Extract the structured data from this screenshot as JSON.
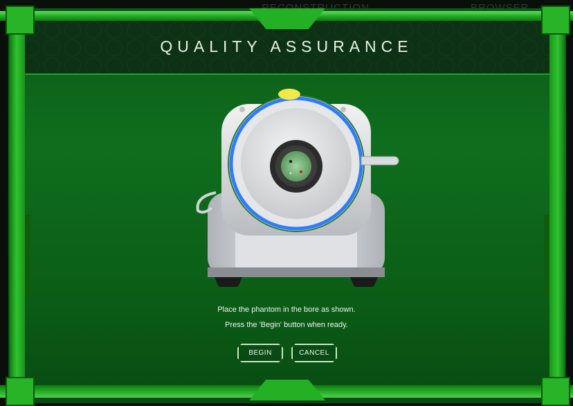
{
  "background_tabs": {
    "reconstruction": "RECONSTRUCTION",
    "browser": "BROWSER"
  },
  "dialog": {
    "title": "QUALITY ASSURANCE",
    "instructions": {
      "line1": "Place the phantom in the bore as shown.",
      "line2": "Press the 'Begin' button when ready."
    },
    "buttons": {
      "begin": "BEGIN",
      "cancel": "CANCEL"
    }
  },
  "colors": {
    "frame_green": "#27b427",
    "panel_green": "#0f6e1d",
    "bore_ring_blue": "#2f7bff",
    "phantom_green": "#7fbf7f",
    "indicator_yellow": "#f2e84a"
  }
}
